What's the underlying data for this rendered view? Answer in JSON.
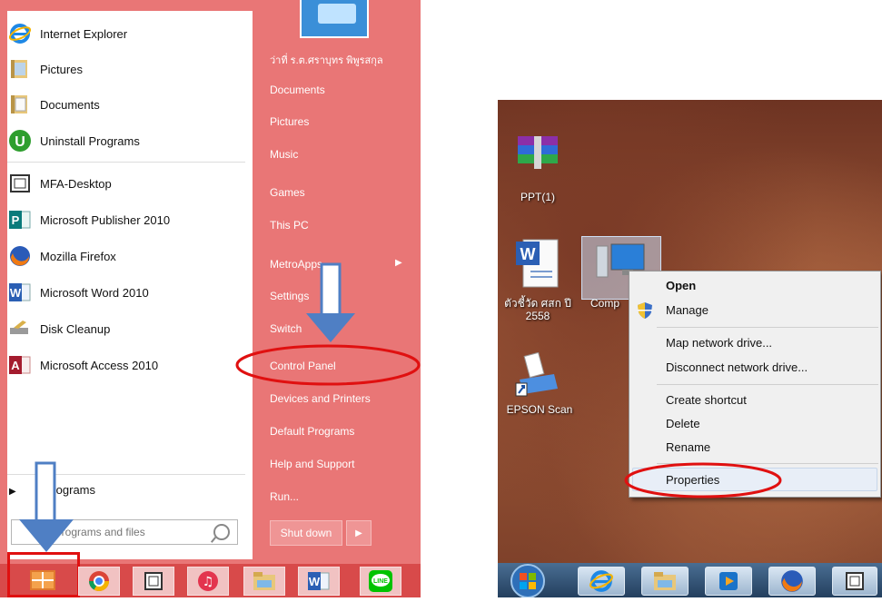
{
  "start_menu": {
    "pinned": [
      {
        "label": "Internet Explorer",
        "icon": "internet-explorer-icon"
      },
      {
        "label": "Pictures",
        "icon": "pictures-folder-icon"
      },
      {
        "label": "Documents",
        "icon": "documents-folder-icon"
      },
      {
        "label": "Uninstall Programs",
        "icon": "uninstall-programs-icon"
      }
    ],
    "recent": [
      {
        "label": "MFA-Desktop",
        "icon": "mfa-desktop-icon"
      },
      {
        "label": "Microsoft Publisher 2010",
        "icon": "publisher-icon"
      },
      {
        "label": "Mozilla Firefox",
        "icon": "firefox-icon"
      },
      {
        "label": "Microsoft Word 2010",
        "icon": "word-icon"
      },
      {
        "label": "Disk Cleanup",
        "icon": "disk-cleanup-icon"
      },
      {
        "label": "Microsoft Access 2010",
        "icon": "access-icon"
      }
    ],
    "all_programs": "rograms",
    "search_placeholder": "programs and files",
    "right_pane": {
      "user": "ว่าที่ ร.ต.ศราบุทร พิพูรสกุล",
      "items": [
        "Documents",
        "Pictures",
        "Music",
        "Games",
        "This PC",
        "MetroApps",
        "Settings",
        "Switch",
        "Control Panel",
        "Devices and Printers",
        "Default Programs",
        "Help and Support",
        "Run..."
      ],
      "shutdown": "Shut down"
    }
  },
  "desktop": {
    "icons": [
      {
        "label": "PPT(1)",
        "icon": "winrar-archive-icon"
      },
      {
        "label": "ตัวชี้วัด ศสก ปี 2558",
        "icon": "word-document-icon"
      },
      {
        "label": "Comp",
        "icon": "computer-icon"
      },
      {
        "label": "EPSON Scan",
        "icon": "epson-scan-icon"
      }
    ],
    "context_menu": {
      "items": [
        "Open",
        "Manage",
        "Map network drive...",
        "Disconnect network drive...",
        "Create shortcut",
        "Delete",
        "Rename",
        "Properties"
      ]
    }
  },
  "colors": {
    "start_menu_accent": "#e97676",
    "taskbar_left": "#d84a4a",
    "highlight_red": "#e01010",
    "arrow_blue": "#4f7fc4"
  }
}
